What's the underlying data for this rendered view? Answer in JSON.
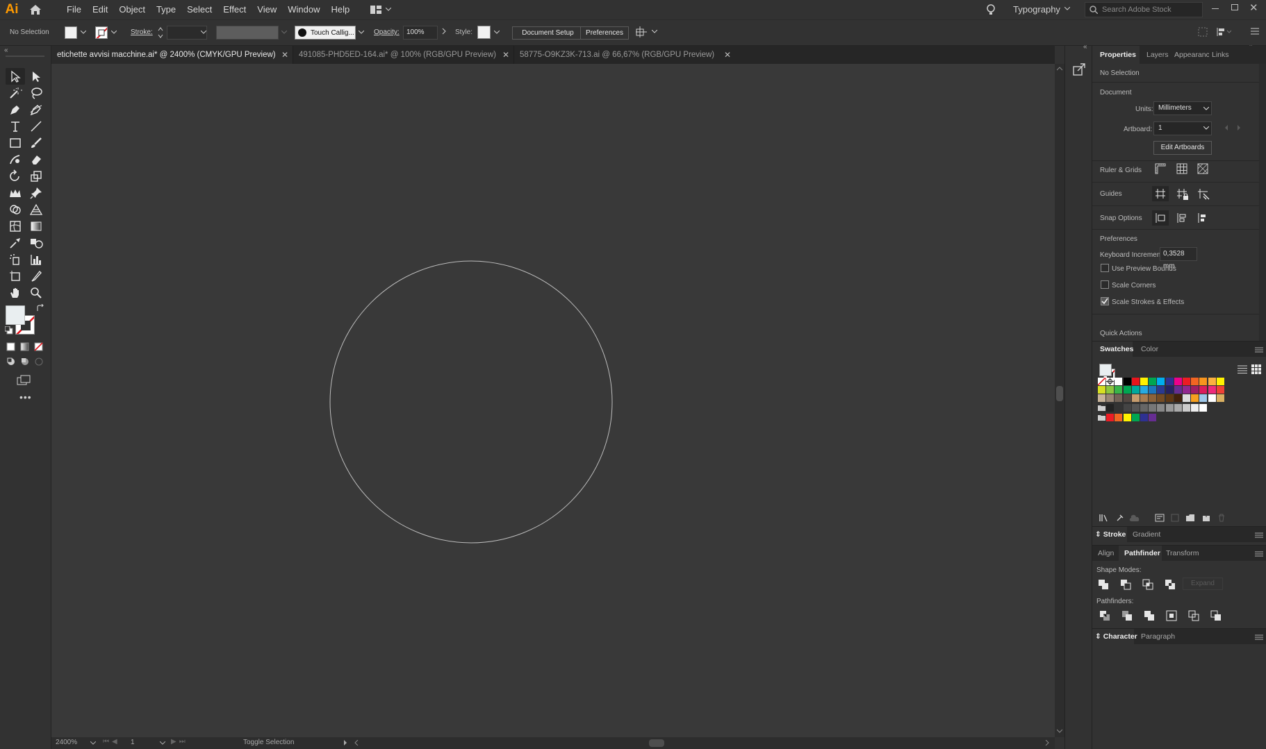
{
  "app": {
    "logo": "Ai",
    "workspace": "Typography",
    "search_placeholder": "Search Adobe Stock"
  },
  "menu": [
    "File",
    "Edit",
    "Object",
    "Type",
    "Select",
    "Effect",
    "View",
    "Window",
    "Help"
  ],
  "control_bar": {
    "selection": "No Selection",
    "stroke_label": "Stroke:",
    "brush": "Touch Callig...",
    "opacity_label": "Opacity:",
    "opacity": "100%",
    "style_label": "Style:",
    "document_setup": "Document Setup",
    "preferences": "Preferences"
  },
  "tabs": [
    {
      "label": "etichette avvisi macchine.ai* @ 2400% (CMYK/GPU Preview)",
      "active": true
    },
    {
      "label": "491085-PHD5ED-164.ai* @ 100% (RGB/GPU Preview)",
      "active": false
    },
    {
      "label": "58775-O9KZ3K-713.ai @ 66,67% (RGB/GPU Preview)",
      "active": false
    }
  ],
  "status": {
    "zoom": "2400%",
    "artboard": "1",
    "tool": "Toggle Selection"
  },
  "properties": {
    "tabs": [
      "Properties",
      "Layers",
      "Appearance",
      "Links"
    ],
    "selection": "No Selection",
    "document": "Document",
    "units_label": "Units:",
    "units": "Millimeters",
    "artboard_label": "Artboard:",
    "artboard": "1",
    "edit_artboards": "Edit Artboards",
    "ruler_grids": "Ruler & Grids",
    "guides": "Guides",
    "snap_options": "Snap Options",
    "preferences": "Preferences",
    "keyboard_increment_label": "Keyboard Increment:",
    "keyboard_increment": "0,3528 mm",
    "use_preview_bounds": "Use Preview Bounds",
    "scale_corners": "Scale Corners",
    "scale_strokes": "Scale Strokes & Effects",
    "quick_actions": "Quick Actions"
  },
  "swatches": {
    "tabs": [
      "Swatches",
      "Color"
    ]
  },
  "stroke_panel": {
    "tabs": [
      "Stroke",
      "Gradient"
    ]
  },
  "pathfinder": {
    "tabs": [
      "Align",
      "Pathfinder",
      "Transform"
    ],
    "shape_modes": "Shape Modes:",
    "expand": "Expand",
    "pathfinders": "Pathfinders:"
  },
  "character": {
    "tabs": [
      "Character",
      "Paragraph"
    ]
  },
  "colors": {
    "accent": "#ff9a00",
    "canvas": "#393939",
    "panel": "#323232"
  }
}
